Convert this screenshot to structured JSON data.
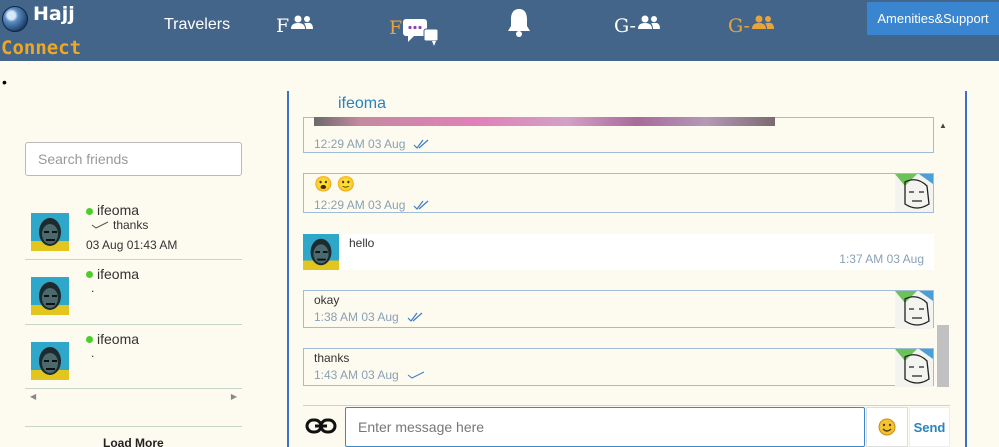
{
  "brand": {
    "line1": "Hajj",
    "line2": "Connect"
  },
  "nav": {
    "travelers": "Travelers",
    "friends_letter": "F",
    "friend_chat_letter": "F",
    "group_letter": "G-",
    "group2_letter": "G-",
    "amenities": "Amenities&Support"
  },
  "colors": {
    "navbar": "#44658a",
    "accent_orange": "#e8a43a",
    "online": "#4ccd2b",
    "link_blue": "#2a83bb",
    "button_blue": "#3a85d0"
  },
  "sidebar": {
    "bullet": "•",
    "search_placeholder": "Search friends",
    "friends": [
      {
        "name": "ifeoma",
        "preview": "thanks",
        "time": "03 Aug 01:43 AM"
      },
      {
        "name": "ifeoma",
        "preview": ".",
        "time": ""
      },
      {
        "name": "ifeoma",
        "preview": ".",
        "time": ""
      }
    ],
    "load_more": "Load More"
  },
  "chat": {
    "contact_name": "ifeoma",
    "messages": [
      {
        "direction": "out",
        "content": "[image]",
        "time": "12:29 AM 03 Aug",
        "status": "read"
      },
      {
        "direction": "out",
        "content": "😮 🙂",
        "time": "12:29 AM 03 Aug",
        "status": "read"
      },
      {
        "direction": "in",
        "content": "hello",
        "time": "1:37 AM 03 Aug"
      },
      {
        "direction": "out",
        "content": "okay",
        "time": "1:38 AM 03 Aug",
        "status": "read"
      },
      {
        "direction": "out",
        "content": "thanks",
        "time": "1:43 AM 03 Aug",
        "status": "sent"
      }
    ],
    "input_placeholder": "Enter message here",
    "send_label": "Send"
  }
}
